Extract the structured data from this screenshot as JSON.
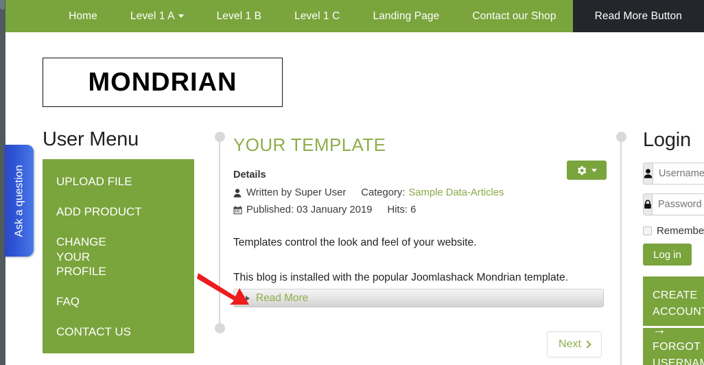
{
  "navbar": {
    "items": [
      {
        "label": "Home",
        "has_caret": false,
        "highlight": false
      },
      {
        "label": "Level 1 A",
        "has_caret": true,
        "highlight": false
      },
      {
        "label": "Level 1 B",
        "has_caret": false,
        "highlight": false
      },
      {
        "label": "Level 1 C",
        "has_caret": false,
        "highlight": false
      },
      {
        "label": "Landing Page",
        "has_caret": false,
        "highlight": false
      },
      {
        "label": "Contact our Shop",
        "has_caret": false,
        "highlight": false
      },
      {
        "label": "Read More Button",
        "has_caret": false,
        "highlight": true
      }
    ],
    "bg_color": "#7aa43c",
    "highlight_color": "#23272b"
  },
  "logo": {
    "text": "MONDRIAN"
  },
  "side_tab": {
    "label": "Ask a question",
    "color": "#2f55d4"
  },
  "user_menu": {
    "title": "User Menu",
    "items": [
      "UPLOAD FILE",
      "ADD PRODUCT",
      "CHANGE YOUR PROFILE",
      "FAQ",
      "CONTACT US"
    ],
    "bg_color": "#7aa43c"
  },
  "article": {
    "title": "YOUR TEMPLATE",
    "title_color": "#8fae4a",
    "details_label": "Details",
    "written_by": "Written by Super User",
    "category_label": "Category:",
    "category_value": "Sample Data-Articles",
    "published": "Published: 03 January 2019",
    "hits": "Hits: 6",
    "paragraph_1": "Templates control the look and feel of your website.",
    "paragraph_2": "This blog is installed with the popular Joomlashack Mondrian template.",
    "read_more": "Read More",
    "next_label": "Next"
  },
  "login": {
    "title": "Login",
    "username_placeholder": "Username",
    "password_placeholder": "Password",
    "username_value": "",
    "password_value": "",
    "remember_label": "Remember Me",
    "login_button": "Log in",
    "create_account": "CREATE ACCOUNT",
    "create_account_arrow": "→",
    "forgot": "FORGOT USERNAME"
  }
}
